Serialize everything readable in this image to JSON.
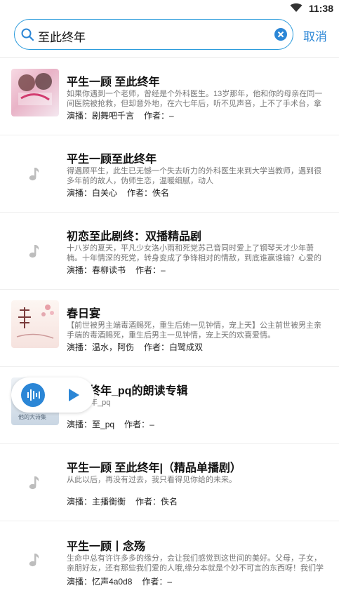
{
  "status": {
    "time": "11:38"
  },
  "search": {
    "query": "至此终年",
    "cancel": "取消"
  },
  "results": [
    {
      "title": "平生一顾 至此终年",
      "desc": "如果你遇到一个老师，曾经是个外科医生。13岁那年，他和你的母亲在同一间医院被抢救，但却意外地，在六七年后，听不见声音，上不了手术台，拿起…",
      "narrator_label": "演播：",
      "narrator": "剧舞吧千言",
      "author_label": "作者：",
      "author": "–",
      "cover": "image",
      "cover_text": "平生一顾 至此终年"
    },
    {
      "title": "平生一顾至此终年",
      "desc": "得遇顾平生，此生已无憾一个失去听力的外科医生来到大学当教师，遇到很多年前的故人，伪师生恋，温暖细腻，动人",
      "narrator_label": "演播：",
      "narrator": "白关心",
      "author_label": "作者：",
      "author": "佚名",
      "cover": "music"
    },
    {
      "title": "初恋至此剧终：双播精品剧",
      "desc": "十八岁的夏天，平凡少女洛小雨和死党苏己音同时爱上了钢琴天才少年萧楠。十年情深的死党，转身变成了争锋相对的情敌，到底谁赢谁输？心爱的少年…",
      "narrator_label": "演播：",
      "narrator": "春柳读书",
      "author_label": "作者：",
      "author": "–",
      "cover": "music"
    },
    {
      "title": "春日宴",
      "desc": "【前世被男主端毒酒赐死，重生后她一见钟情，宠上天】公主前世被男主亲手端的毒酒赐死，重生后男主一见钟情，宠上天的欢喜爱情。",
      "narrator_label": "演播：",
      "narrator": "温水，阿伤",
      "author_label": "作者：",
      "author": "白鹭成双",
      "cover": "image",
      "cover_text": "春日宴"
    },
    {
      "title": "至此终年_pq的朗读专辑",
      "desc": "至此终年_pq",
      "narrator_label": "演播：",
      "narrator": "至_pq",
      "author_label": "作者：",
      "author": "–",
      "cover": "image",
      "cover_text": "他的大诗集"
    },
    {
      "title": "平生一顾 至此终年|（精品单播剧）",
      "desc": "从此以后，再没有过去，我只看得见你给的未来。",
      "narrator_label": "演播：",
      "narrator": "主播衡衡",
      "author_label": "作者：",
      "author": "佚名",
      "cover": "music"
    },
    {
      "title": "平生一顾丨念殇",
      "desc": "生命中总有许许多多的缘分，会让我们感觉到这世间的美好。父母，子女，亲朋好友，还有那些我们爱的人哦,缘分本就是个妙不可言的东西呀！我们学习…",
      "narrator_label": "演播：",
      "narrator": "忆声4a0d8",
      "author_label": "作者：",
      "author": "–",
      "cover": "music"
    }
  ],
  "colors": {
    "accent": "#2b86d6",
    "search_border": "#2b9bdc"
  }
}
